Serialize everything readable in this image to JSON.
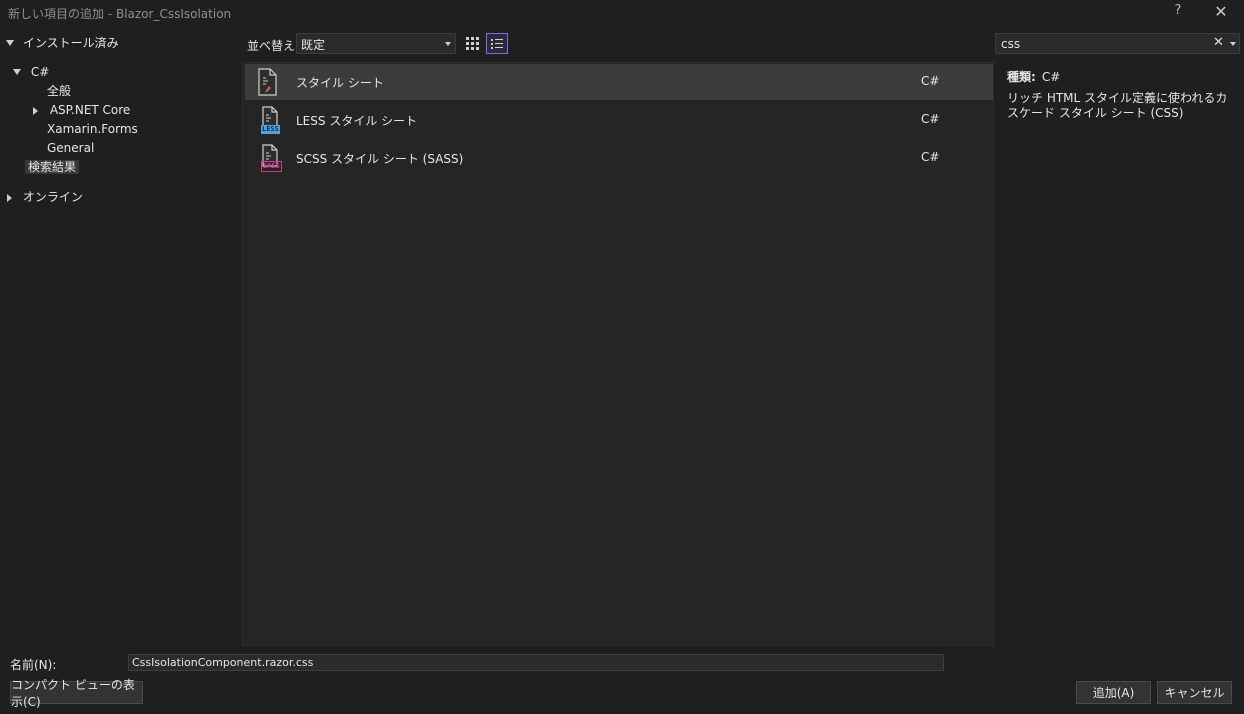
{
  "window": {
    "title": "新しい項目の追加 - Blazor_CssIsolation",
    "help_glyph": "?",
    "close_glyph": "✕"
  },
  "tree": {
    "installed": "インストール済み",
    "csharp": "C#",
    "all": "全般",
    "aspnet": "ASP.NET Core",
    "xamarin": "Xamarin.Forms",
    "general": "General",
    "search_results": "検索結果",
    "online": "オンライン"
  },
  "toolbar": {
    "sort_label": "並べ替え:",
    "sort_value": "既定"
  },
  "items": [
    {
      "name": "スタイル シート",
      "lang": "C#",
      "badge": ""
    },
    {
      "name": "LESS スタイル シート",
      "lang": "C#",
      "badge": "LESS",
      "badge_color": "#4fa3e0"
    },
    {
      "name": "SCSS スタイル シート (SASS)",
      "lang": "C#",
      "badge": "SASS",
      "badge_color": "#d6338f"
    }
  ],
  "search": {
    "value": "css",
    "clear_glyph": "✕"
  },
  "details": {
    "type_label": "種類:",
    "type_value": "C#",
    "description": "リッチ HTML スタイル定義に使われるカスケード スタイル シート (CSS)"
  },
  "bottom": {
    "name_label": "名前(N):",
    "name_value": "CssIsolationComponent.razor.css",
    "compact_view": "コンパクト ビューの表示(C)",
    "add": "追加(A)",
    "cancel": "キャンセル"
  }
}
